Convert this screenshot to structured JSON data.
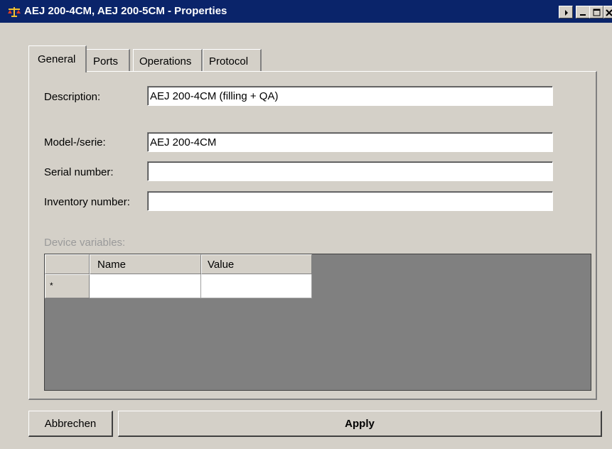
{
  "window": {
    "title": "AEJ 200-4CM, AEJ 200-5CM - Properties",
    "icon": "scale-icon",
    "controls": [
      "help-arrow",
      "minimize",
      "maximize",
      "close"
    ]
  },
  "tabs": [
    {
      "label": "General",
      "active": true
    },
    {
      "label": "Ports",
      "active": false
    },
    {
      "label": "Operations",
      "active": false
    },
    {
      "label": "Protocol",
      "active": false
    }
  ],
  "form": {
    "description_label": "Description:",
    "description_value": "AEJ 200-4CM (filling + QA)",
    "model_label": "Model-/serie:",
    "model_value": "AEJ 200-4CM",
    "serial_label": "Serial number:",
    "serial_value": "",
    "inventory_label": "Inventory number:",
    "inventory_value": ""
  },
  "device_variables": {
    "label": "Device variables:",
    "columns": [
      "Name",
      "Value"
    ],
    "new_row_marker": "*"
  },
  "buttons": {
    "cancel": "Abbrechen",
    "apply": "Apply"
  },
  "colors": {
    "titlebar": "#0a246a",
    "dialog_bg": "#d4d0c8",
    "grid_bg": "#808080"
  }
}
